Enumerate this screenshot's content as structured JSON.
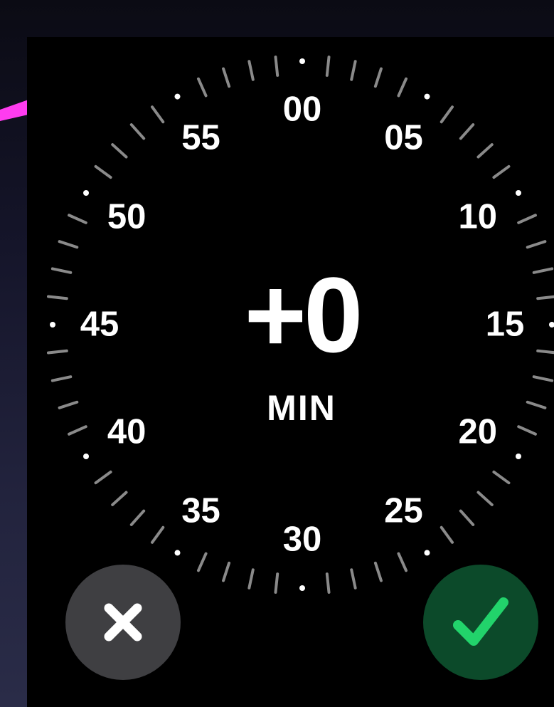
{
  "dial": {
    "labels": [
      "00",
      "05",
      "10",
      "15",
      "20",
      "25",
      "30",
      "35",
      "40",
      "45",
      "50",
      "55"
    ]
  },
  "timer": {
    "value": "+0",
    "unit": "MIN"
  },
  "actions": {
    "cancel_icon": "close-icon",
    "confirm_icon": "checkmark-icon"
  },
  "colors": {
    "screen_bg": "#000000",
    "accent_green": "#22d36b",
    "confirm_bg": "#0c4a2a",
    "cancel_bg": "#3f3f42",
    "pointer": "#ff3cf0"
  }
}
